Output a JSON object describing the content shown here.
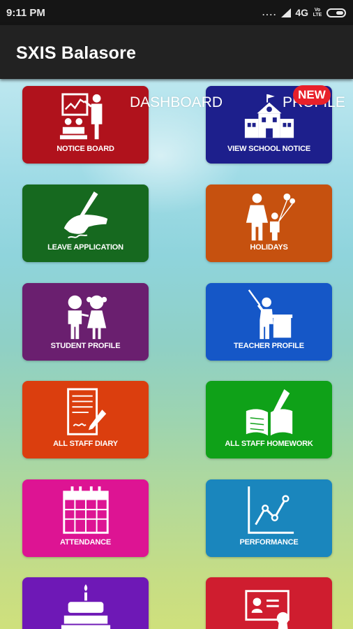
{
  "status_bar": {
    "time": "9:11 PM",
    "signal_dots": "....",
    "network": "4G",
    "volte": "Vo LTE"
  },
  "app_bar": {
    "title": "SXIS Balasore"
  },
  "overlay": {
    "dashboard": "DASHBOARD",
    "profile": "PROFILE",
    "badge": "NEW"
  },
  "tiles": [
    {
      "label": "NOTICE BOARD",
      "icon": "teacher-board-icon",
      "color": "#b0121c"
    },
    {
      "label": "VIEW SCHOOL NOTICE",
      "icon": "school-building-icon",
      "color": "#1d1f8c"
    },
    {
      "label": "LEAVE APPLICATION",
      "icon": "hand-writing-icon",
      "color": "#16691f"
    },
    {
      "label": "HOLIDAYS",
      "icon": "family-balloon-icon",
      "color": "#c6510f"
    },
    {
      "label": "STUDENT PROFILE",
      "icon": "students-icon",
      "color": "#6a1f6f"
    },
    {
      "label": "TEACHER PROFILE",
      "icon": "teacher-pointer-icon",
      "color": "#1557c7"
    },
    {
      "label": "ALL STAFF DIARY",
      "icon": "diary-pen-icon",
      "color": "#db3e0e"
    },
    {
      "label": "ALL STAFF HOMEWORK",
      "icon": "open-book-icon",
      "color": "#0fa118"
    },
    {
      "label": "ATTENDANCE",
      "icon": "calendar-icon",
      "color": "#dd1493"
    },
    {
      "label": "PERFORMANCE",
      "icon": "line-chart-icon",
      "color": "#1a86bd"
    },
    {
      "label": "",
      "icon": "birthday-cake-icon",
      "color": "#6e18b6"
    },
    {
      "label": "",
      "icon": "certificate-icon",
      "color": "#cf1d2f"
    }
  ]
}
